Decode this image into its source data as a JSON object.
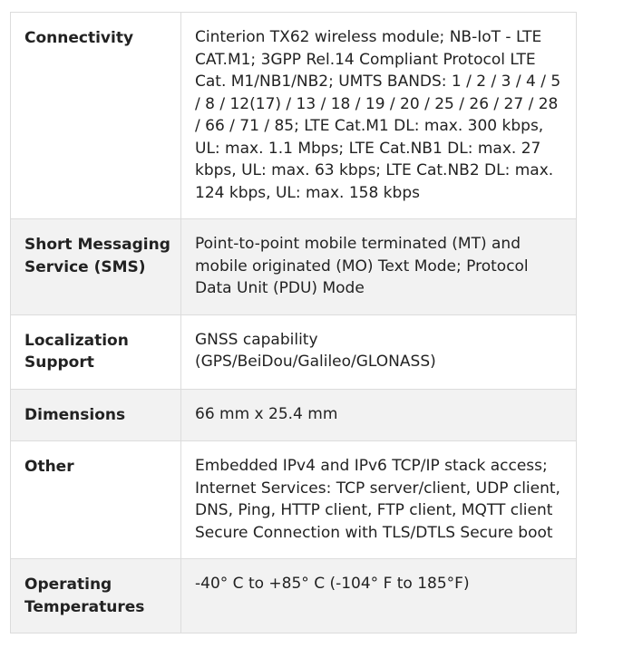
{
  "specs": [
    {
      "label": "Connectivity",
      "value": "Cinterion TX62 wireless module; NB-IoT - LTE CAT.M1; 3GPP Rel.14 Compliant Protocol LTE Cat. M1/NB1/NB2; UMTS BANDS: 1 / 2 / 3 / 4 / 5 / 8 / 12(17) / 13 / 18 / 19 / 20 / 25 / 26 / 27 / 28 / 66 / 71 / 85; LTE Cat.M1 DL: max. 300 kbps, UL: max. 1.1 Mbps; LTE Cat.NB1 DL: max. 27 kbps, UL: max. 63 kbps; LTE Cat.NB2 DL: max. 124 kbps, UL: max. 158 kbps"
    },
    {
      "label": "Short Messaging Service (SMS)",
      "value": "Point-to-point mobile terminated (MT) and mobile originated (MO) Text Mode; Protocol Data Unit (PDU) Mode"
    },
    {
      "label": "Localization Support",
      "value": "GNSS capability (GPS/BeiDou/Galileo/GLONASS)"
    },
    {
      "label": "Dimensions",
      "value": "66 mm x 25.4 mm"
    },
    {
      "label": "Other",
      "value": "Embedded IPv4 and IPv6 TCP/IP stack access; Internet Services: TCP server/client, UDP client, DNS, Ping, HTTP client, FTP client, MQTT client Secure Connection with TLS/DTLS Secure boot"
    },
    {
      "label": "Operating Temperatures",
      "value": "-40° C to +85° C (-104° F to 185°F)"
    }
  ]
}
